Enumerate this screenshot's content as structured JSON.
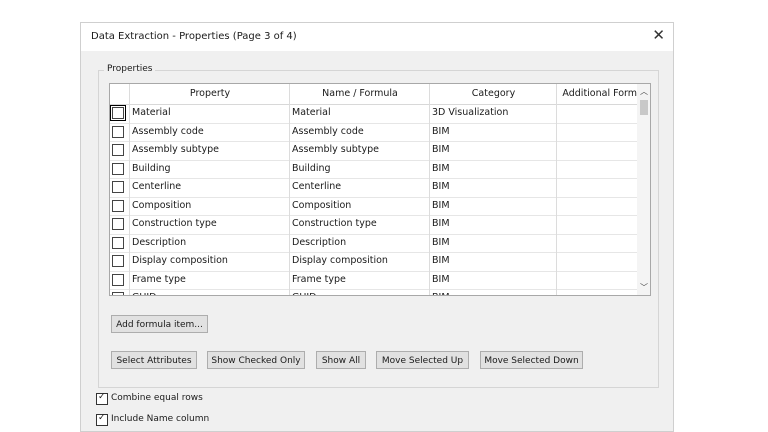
{
  "window": {
    "title": "Data Extraction - Properties (Page 3 of 4)"
  },
  "properties_group": {
    "label": "Properties"
  },
  "grid": {
    "columns": [
      "Property",
      "Name / Formula",
      "Category",
      "Additional Format"
    ],
    "rows": [
      {
        "checked": false,
        "property": "Material",
        "name": "Material",
        "category": "3D Visualization",
        "format": ""
      },
      {
        "checked": false,
        "property": "Assembly code",
        "name": "Assembly code",
        "category": "BIM",
        "format": ""
      },
      {
        "checked": false,
        "property": "Assembly subtype",
        "name": "Assembly subtype",
        "category": "BIM",
        "format": ""
      },
      {
        "checked": false,
        "property": "Building",
        "name": "Building",
        "category": "BIM",
        "format": ""
      },
      {
        "checked": false,
        "property": "Centerline",
        "name": "Centerline",
        "category": "BIM",
        "format": ""
      },
      {
        "checked": false,
        "property": "Composition",
        "name": "Composition",
        "category": "BIM",
        "format": ""
      },
      {
        "checked": false,
        "property": "Construction type",
        "name": "Construction type",
        "category": "BIM",
        "format": ""
      },
      {
        "checked": false,
        "property": "Description",
        "name": "Description",
        "category": "BIM",
        "format": ""
      },
      {
        "checked": false,
        "property": "Display composition",
        "name": "Display composition",
        "category": "BIM",
        "format": ""
      },
      {
        "checked": false,
        "property": "Frame type",
        "name": "Frame type",
        "category": "BIM",
        "format": ""
      },
      {
        "checked": false,
        "property": "GUID",
        "name": "GUID",
        "category": "BIM",
        "format": ""
      }
    ]
  },
  "buttons": {
    "add_formula": "Add formula item...",
    "select_attributes": "Select Attributes",
    "show_checked_only": "Show Checked Only",
    "show_all": "Show All",
    "move_up": "Move Selected Up",
    "move_down": "Move Selected Down"
  },
  "options": {
    "combine_equal_rows": {
      "label": "Combine equal rows",
      "checked": true
    },
    "include_name_column": {
      "label": "Include Name column",
      "checked": true
    }
  }
}
